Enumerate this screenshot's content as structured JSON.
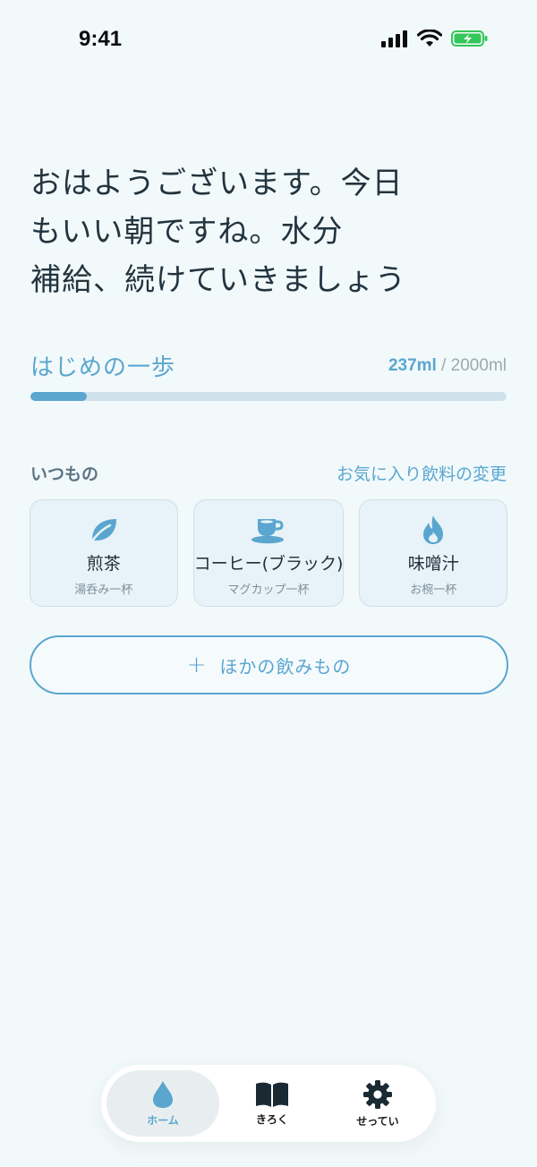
{
  "status": {
    "time": "9:41"
  },
  "greeting": {
    "line1": "おはようございます。今日",
    "line2": "もいい朝ですね。水分",
    "line3": "補給、続けていきましょう"
  },
  "progress": {
    "title": "はじめの一歩",
    "current": "237ml",
    "separator": " / ",
    "goal": "2000ml",
    "fraction": 0.1185
  },
  "favorites": {
    "label": "いつもの",
    "change_link": "お気に入り飲料の変更",
    "items": [
      {
        "name": "煎茶",
        "sub": "湯呑み一杯",
        "icon": "leaf-icon"
      },
      {
        "name": "コーヒー(ブラック)",
        "sub": "マグカップ一杯",
        "icon": "coffee-cup-icon"
      },
      {
        "name": "味噌汁",
        "sub": "お椀一杯",
        "icon": "flame-icon"
      }
    ]
  },
  "other_button": {
    "plus": "+",
    "label": "ほかの飲みもの"
  },
  "tabs": [
    {
      "label": "ホーム",
      "icon": "drop-icon",
      "active": true
    },
    {
      "label": "きろく",
      "icon": "book-icon",
      "active": false
    },
    {
      "label": "せってい",
      "icon": "gear-icon",
      "active": false
    }
  ],
  "colors": {
    "accent": "#5aa6cf",
    "background": "#f2f9fb",
    "battery": "#34c759"
  }
}
